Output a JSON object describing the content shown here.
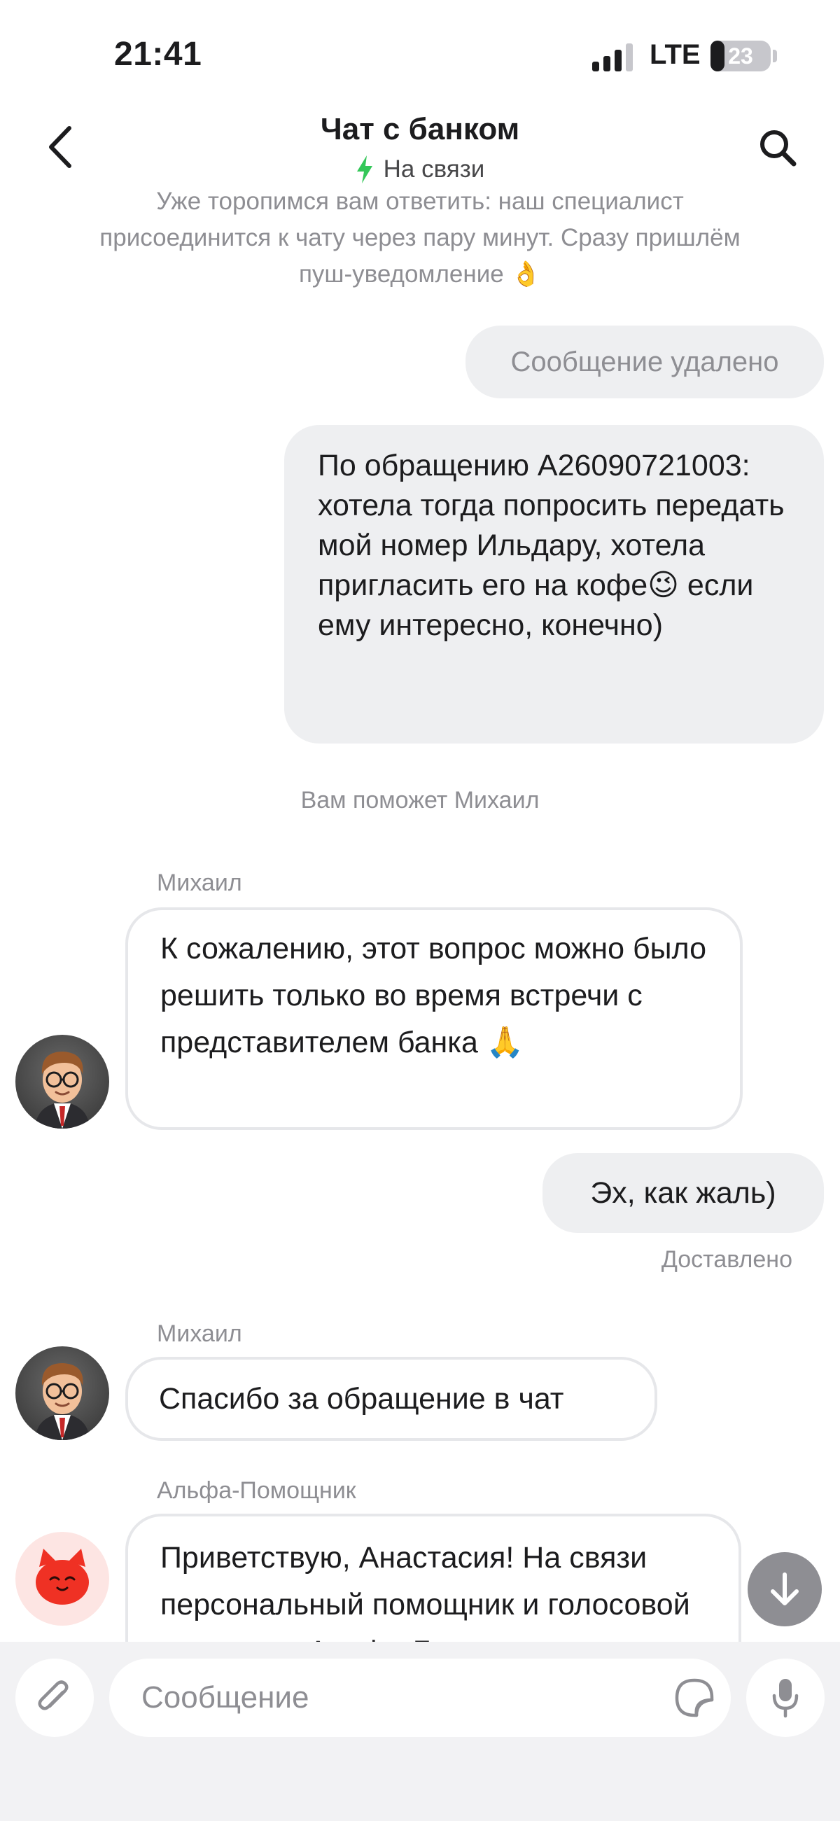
{
  "status_bar": {
    "time": "21:41",
    "network": "LTE",
    "battery": "23",
    "battery_level": 0.23
  },
  "header": {
    "title": "Чат с банком",
    "status": "На связи",
    "back_icon": "chevron-left-icon",
    "search_icon": "search-icon",
    "status_icon": "lightning-icon",
    "status_color": "#34c759"
  },
  "messages": {
    "system_note": "Уже торопимся вам ответить: наш специалист присоединится к чату через пару минут. Сразу пришлём пуш-уведомление 👌",
    "deleted": "Сообщение удалено",
    "outgoing_1": "По обращению A26090721003: хотела тогда попросить передать мой номер Ильдару, хотела пригласить его на кофе😉 если ему интересно, конечно)",
    "assigned_note": "Вам поможет Михаил",
    "sender_1": "Михаил",
    "incoming_1": "К сожалению, этот вопрос можно было решить только во время встречи с представителем банка 🙏",
    "outgoing_2": "Эх, как жаль)",
    "delivered": "Доставлено",
    "sender_2": "Михаил",
    "incoming_2": "Спасибо за обращение в чат",
    "sender_3": "Альфа-Помощник",
    "incoming_3": "Приветствую, Анастасия! На связи персональный помощник и голосовой ассистент Альфа-Б"
  },
  "input": {
    "placeholder": "Сообщение",
    "attach_icon": "paperclip-icon",
    "sticker_icon": "sticker-icon",
    "mic_icon": "microphone-icon",
    "scroll_icon": "arrow-down-icon"
  }
}
